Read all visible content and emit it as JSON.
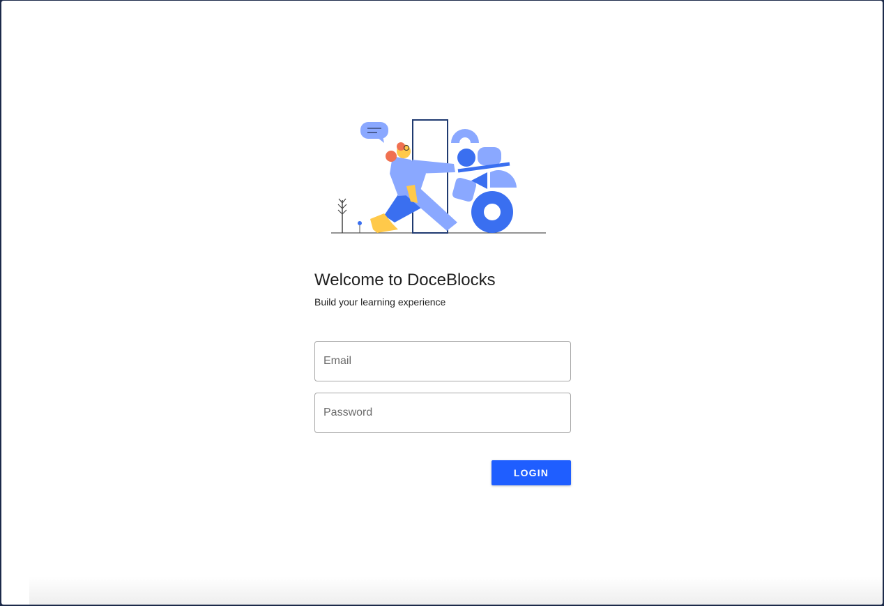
{
  "colors": {
    "primary": "#1f5eff",
    "illustration_blue": "#3a6ff0",
    "illustration_light_blue": "#8aa8ff",
    "illustration_yellow": "#ffc94a",
    "illustration_red": "#f07050"
  },
  "login": {
    "title": "Welcome to DoceBlocks",
    "subtitle": "Build your learning experience",
    "email_placeholder": "Email",
    "password_placeholder": "Password",
    "login_label": "LOGIN"
  }
}
